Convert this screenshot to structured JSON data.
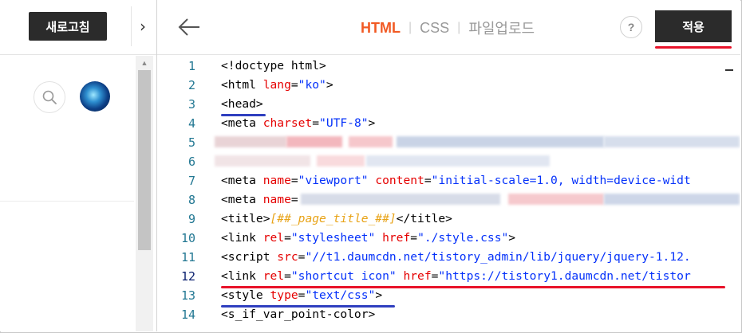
{
  "sidebar": {
    "refresh_label": "새로고침",
    "collapse_glyph": "›",
    "scroll_up_glyph": "▲"
  },
  "header": {
    "back_glyph": "←",
    "tabs": [
      {
        "label": "HTML",
        "active": true
      },
      {
        "label": "CSS",
        "active": false
      },
      {
        "label": "파일업로드",
        "active": false
      }
    ],
    "help_label": "?",
    "apply_label": "적용"
  },
  "editor": {
    "line_numbers": [
      "1",
      "2",
      "3",
      "4",
      "5",
      "6",
      "7",
      "8",
      "9",
      "10",
      "11",
      "12",
      "13",
      "14"
    ],
    "current_line": "12",
    "lines": [
      {
        "n": "1",
        "tokens": [
          {
            "t": "<!doctype html>",
            "c": "plain"
          }
        ]
      },
      {
        "n": "2",
        "tokens": [
          {
            "t": "<html ",
            "c": "plain"
          },
          {
            "t": "lang",
            "c": "attr"
          },
          {
            "t": "=",
            "c": "plain"
          },
          {
            "t": "\"ko\"",
            "c": "str"
          },
          {
            "t": ">",
            "c": "plain"
          }
        ]
      },
      {
        "n": "3",
        "tokens": [
          {
            "t": "<head>",
            "c": "plain"
          }
        ]
      },
      {
        "n": "4",
        "tokens": [
          {
            "t": "<meta ",
            "c": "plain"
          },
          {
            "t": "charset",
            "c": "attr"
          },
          {
            "t": "=",
            "c": "plain"
          },
          {
            "t": "\"UTF-8\"",
            "c": "str"
          },
          {
            "t": ">",
            "c": "plain"
          }
        ]
      },
      {
        "n": "5",
        "tokens": []
      },
      {
        "n": "6",
        "tokens": []
      },
      {
        "n": "7",
        "tokens": [
          {
            "t": "<meta ",
            "c": "plain"
          },
          {
            "t": "name",
            "c": "attr"
          },
          {
            "t": "=",
            "c": "plain"
          },
          {
            "t": "\"viewport\"",
            "c": "str"
          },
          {
            "t": " ",
            "c": "plain"
          },
          {
            "t": "content",
            "c": "attr"
          },
          {
            "t": "=",
            "c": "plain"
          },
          {
            "t": "\"initial-scale=1.0, width=device-widt",
            "c": "str"
          }
        ]
      },
      {
        "n": "8",
        "tokens": [
          {
            "t": "<meta ",
            "c": "plain"
          },
          {
            "t": "name",
            "c": "attr"
          },
          {
            "t": "=",
            "c": "plain"
          }
        ]
      },
      {
        "n": "9",
        "tokens": [
          {
            "t": "<title>",
            "c": "plain"
          },
          {
            "t": "[##_page_title_##]",
            "c": "tpl"
          },
          {
            "t": "</title>",
            "c": "plain"
          }
        ]
      },
      {
        "n": "10",
        "tokens": [
          {
            "t": "<link ",
            "c": "plain"
          },
          {
            "t": "rel",
            "c": "attr"
          },
          {
            "t": "=",
            "c": "plain"
          },
          {
            "t": "\"stylesheet\"",
            "c": "str"
          },
          {
            "t": " ",
            "c": "plain"
          },
          {
            "t": "href",
            "c": "attr"
          },
          {
            "t": "=",
            "c": "plain"
          },
          {
            "t": "\"./style.css\"",
            "c": "str"
          },
          {
            "t": ">",
            "c": "plain"
          }
        ]
      },
      {
        "n": "11",
        "tokens": [
          {
            "t": "<script ",
            "c": "plain"
          },
          {
            "t": "src",
            "c": "attr"
          },
          {
            "t": "=",
            "c": "plain"
          },
          {
            "t": "\"//t1.daumcdn.net/tistory_admin/lib/jquery/jquery-1.12.",
            "c": "str"
          }
        ]
      },
      {
        "n": "12",
        "tokens": [
          {
            "t": "<link ",
            "c": "plain"
          },
          {
            "t": "rel",
            "c": "attr"
          },
          {
            "t": "=",
            "c": "plain"
          },
          {
            "t": "\"shortcut icon\"",
            "c": "str"
          },
          {
            "t": " ",
            "c": "plain"
          },
          {
            "t": "href",
            "c": "attr"
          },
          {
            "t": "=",
            "c": "plain"
          },
          {
            "t": "\"https://tistory1.daumcdn.net/tistor",
            "c": "str"
          }
        ]
      },
      {
        "n": "13",
        "tokens": [
          {
            "t": "<style ",
            "c": "plain"
          },
          {
            "t": "type",
            "c": "attr"
          },
          {
            "t": "=",
            "c": "plain"
          },
          {
            "t": "\"text/css\"",
            "c": "str"
          },
          {
            "t": ">",
            "c": "plain"
          }
        ]
      },
      {
        "n": "14",
        "tokens": [
          {
            "t": "<s_if_var_point-color>",
            "c": "plain"
          }
        ]
      }
    ]
  },
  "colors": {
    "accent": "#f15a24",
    "button_dark": "#2b2b2b",
    "annotation_red": "#e8132a",
    "annotation_blue": "#2f3fbf",
    "line_number": "#237893",
    "attr": "#e50000",
    "string": "#0431fa",
    "template": "#e8a317"
  }
}
